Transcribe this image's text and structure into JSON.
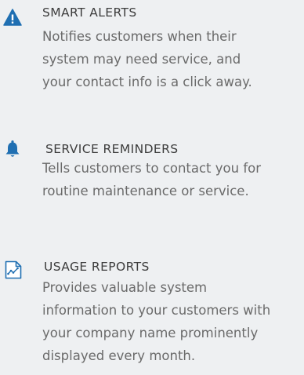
{
  "features": [
    {
      "icon": "warning-triangle-icon",
      "title": "SMART ALERTS",
      "lines": [
        "Notifies customers when their",
        "system may need service, and",
        "your contact info is a click away."
      ]
    },
    {
      "icon": "bell-icon",
      "title": "SERVICE REMINDERS",
      "lines": [
        "Tells customers to contact you for",
        "routine maintenance or service."
      ]
    },
    {
      "icon": "report-chart-icon",
      "title": "USAGE REPORTS",
      "lines": [
        "Provides valuable system",
        "information to your customers with",
        "your company name prominently",
        "displayed every month."
      ]
    }
  ],
  "colors": {
    "background": "#eef0f2",
    "accent": "#1f6fb2",
    "title": "#3d3d3d",
    "text": "#6a6a6a"
  }
}
